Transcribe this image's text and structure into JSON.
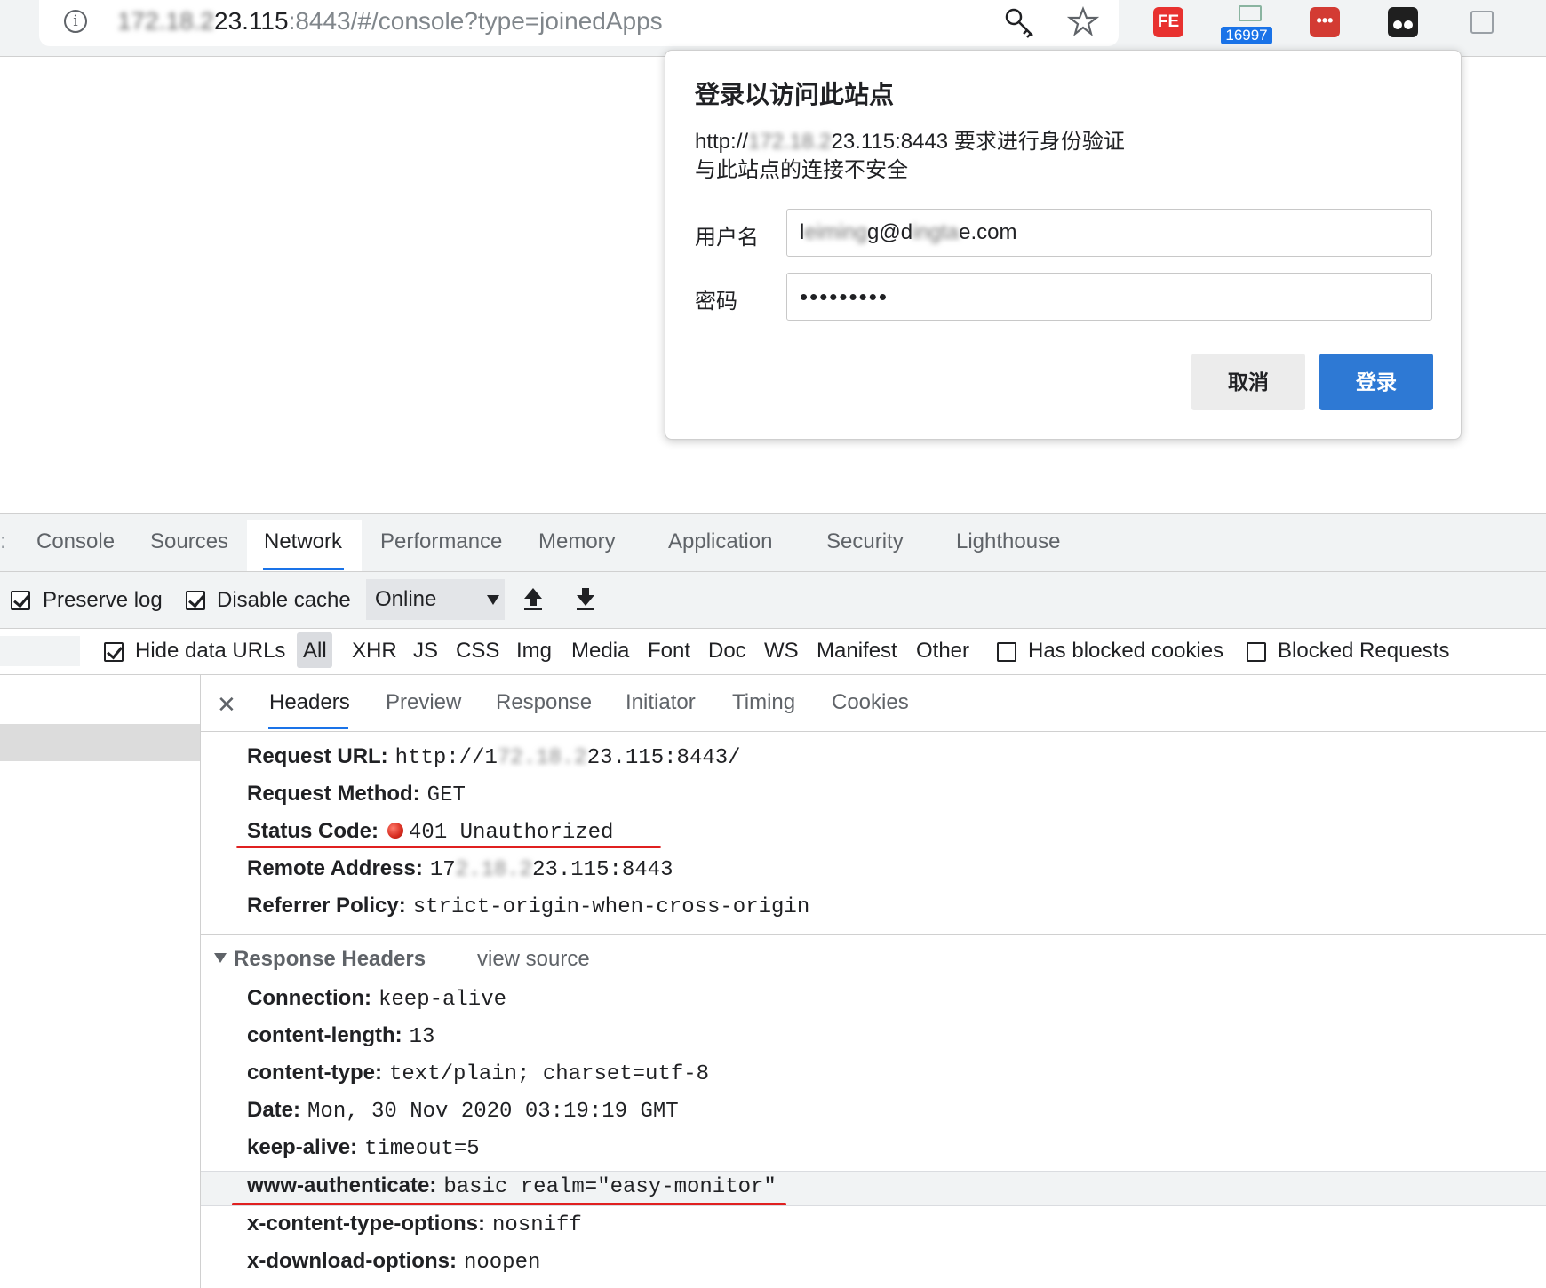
{
  "browser": {
    "url_blurred": "172.18.2",
    "url_host_tail": "23.115",
    "url_rest": ":8443/#/console?type=joinedApps",
    "extension_badge": "16997"
  },
  "dialog": {
    "title": "登录以访问此站点",
    "line1_prefix": "http://",
    "line1_blurred": "172.18.2",
    "line1_suffix": "23.115:8443 要求进行身份验证",
    "line2": "与此站点的连接不安全",
    "username_label": "用户名",
    "username_prefix": "l",
    "username_blurred1": "eiming",
    "username_mid": "g@d",
    "username_blurred2": "ingta",
    "username_suffix": "e.com",
    "password_label": "密码",
    "password_value": "•••••••••",
    "cancel_label": "取消",
    "login_label": "登录"
  },
  "devtools": {
    "tabs": [
      "Console",
      "Sources",
      "Network",
      "Performance",
      "Memory",
      "Application",
      "Security",
      "Lighthouse"
    ],
    "active_tab": "Network",
    "toolbar": {
      "preserve_log": "Preserve log",
      "disable_cache": "Disable cache",
      "throttle": "Online"
    },
    "filter": {
      "hide_data_urls": "Hide data URLs",
      "types": [
        "All",
        "XHR",
        "JS",
        "CSS",
        "Img",
        "Media",
        "Font",
        "Doc",
        "WS",
        "Manifest",
        "Other"
      ],
      "has_blocked_cookies": "Has blocked cookies",
      "blocked_requests": "Blocked Requests"
    },
    "detail_tabs": [
      "Headers",
      "Preview",
      "Response",
      "Initiator",
      "Timing",
      "Cookies"
    ],
    "general": {
      "request_url_key": "Request URL:",
      "request_url_prefix": "http://1",
      "request_url_blurred": "72.18.2",
      "request_url_suffix": "23.115:8443/",
      "request_method_key": "Request Method:",
      "request_method": "GET",
      "status_code_key": "Status Code:",
      "status_code": "401 Unauthorized",
      "remote_address_key": "Remote Address:",
      "remote_address_prefix": "17",
      "remote_address_blurred": "2.18.2",
      "remote_address_suffix": "23.115:8443",
      "referrer_policy_key": "Referrer Policy:",
      "referrer_policy": "strict-origin-when-cross-origin"
    },
    "response_headers": {
      "title": "Response Headers",
      "view_source": "view source",
      "rows": [
        {
          "key": "Connection:",
          "value": "keep-alive"
        },
        {
          "key": "content-length:",
          "value": "13"
        },
        {
          "key": "content-type:",
          "value": "text/plain; charset=utf-8"
        },
        {
          "key": "Date:",
          "value": "Mon, 30 Nov 2020 03:19:19 GMT"
        },
        {
          "key": "keep-alive:",
          "value": "timeout=5"
        },
        {
          "key": "www-authenticate:",
          "value": "basic realm=\"easy-monitor\""
        },
        {
          "key": "x-content-type-options:",
          "value": "nosniff"
        },
        {
          "key": "x-download-options:",
          "value": "noopen"
        }
      ]
    }
  },
  "colors": {
    "accent_blue": "#1a73e8",
    "login_button": "#2e79d4",
    "annotation_red": "#e02020",
    "status_red": "#d62b1e"
  }
}
